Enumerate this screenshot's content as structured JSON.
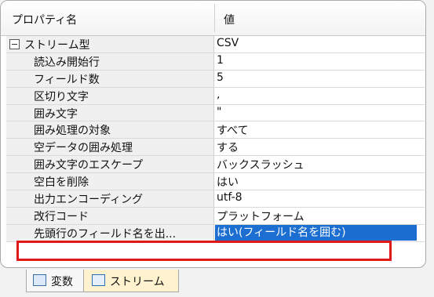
{
  "header": {
    "col_name": "プロパティ名",
    "col_value": "値"
  },
  "rows": [
    {
      "key": "ストリーム型",
      "value": "CSV"
    },
    {
      "key": "読込み開始行",
      "value": "1"
    },
    {
      "key": "フィールド数",
      "value": "5"
    },
    {
      "key": "区切り文字",
      "value": ","
    },
    {
      "key": "囲み文字",
      "value": "\""
    },
    {
      "key": "囲み処理の対象",
      "value": "すべて"
    },
    {
      "key": "空データの囲み処理",
      "value": "する"
    },
    {
      "key": "囲み文字のエスケープ",
      "value": "バックスラッシュ"
    },
    {
      "key": "空白を削除",
      "value": "はい"
    },
    {
      "key": "出力エンコーディング",
      "value": "utf-8"
    },
    {
      "key": "改行コード",
      "value": "プラットフォーム"
    },
    {
      "key": "先頭行のフィールド名を出...",
      "value": "はい(フィールド名を囲む)"
    }
  ],
  "tabs": [
    {
      "label": "変数",
      "icon": "variable-icon"
    },
    {
      "label": "ストリーム",
      "icon": "stream-icon"
    }
  ],
  "colors": {
    "selection": "#1c6fd0",
    "highlight_box": "#e01818",
    "active_tab": "#fff3cf"
  }
}
